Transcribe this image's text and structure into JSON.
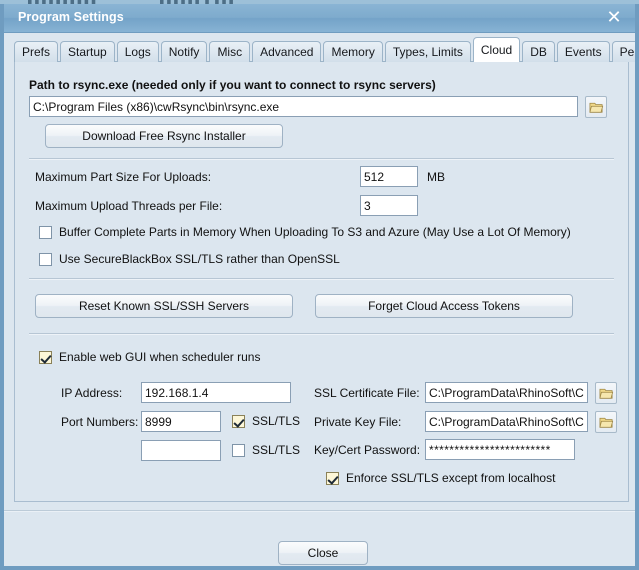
{
  "background": {
    "ghost_text_1": "▌▌▌▌▌▌▌▌▌▌",
    "ghost_text_2": "▌▌▌▌▌▌ ▌ ▌▌▌"
  },
  "window": {
    "title": "Program Settings",
    "close_icon": "✕"
  },
  "tabs": [
    {
      "label": "Prefs",
      "active": false
    },
    {
      "label": "Startup",
      "active": false
    },
    {
      "label": "Logs",
      "active": false
    },
    {
      "label": "Notify",
      "active": false
    },
    {
      "label": "Misc",
      "active": false
    },
    {
      "label": "Advanced",
      "active": false
    },
    {
      "label": "Memory",
      "active": false
    },
    {
      "label": "Types, Limits",
      "active": false
    },
    {
      "label": "Cloud",
      "active": true
    },
    {
      "label": "DB",
      "active": false
    },
    {
      "label": "Events",
      "active": false
    },
    {
      "label": "Performance",
      "active": false
    }
  ],
  "rsync": {
    "label": "Path to rsync.exe  (needed only if you want to connect to rsync servers)",
    "path_value": "C:\\Program Files (x86)\\cwRsync\\bin\\rsync.exe",
    "path_placeholder": "",
    "browse_icon": "folder-icon",
    "download_button": "Download Free Rsync Installer"
  },
  "uploads": {
    "part_size_label": "Maximum Part Size For Uploads:",
    "part_size_value": "512",
    "part_size_unit": "MB",
    "threads_label": "Maximum Upload Threads per File:",
    "threads_value": "3",
    "buffer_checkbox": {
      "label": "Buffer Complete Parts in Memory When Uploading To S3 and Azure (May Use a Lot Of Memory)",
      "checked": false
    },
    "secureblackbox_checkbox": {
      "label": "Use SecureBlackBox SSL/TLS rather than OpenSSL",
      "checked": false
    }
  },
  "actions": {
    "reset_servers": "Reset Known SSL/SSH Servers",
    "forget_tokens": "Forget Cloud Access Tokens"
  },
  "webgui": {
    "enable_checkbox": {
      "label": "Enable web GUI when scheduler runs",
      "checked": true
    },
    "ip_label": "IP Address:",
    "ip_value": "192.168.1.4",
    "port_label": "Port Numbers:",
    "port1_value": "8999",
    "port1_ssl": {
      "label": "SSL/TLS",
      "checked": true
    },
    "port2_value": "",
    "port2_ssl": {
      "label": "SSL/TLS",
      "checked": false
    },
    "cert_label": "SSL Certificate File:",
    "cert_value": "C:\\ProgramData\\RhinoSoft\\Cer",
    "key_label": "Private Key File:",
    "key_value": "C:\\ProgramData\\RhinoSoft\\Cer",
    "password_label": "Key/Cert Password:",
    "password_value": "************************",
    "enforce_checkbox": {
      "label": "Enforce SSL/TLS except from localhost",
      "checked": true
    },
    "browse_icon": "folder-icon"
  },
  "footer": {
    "close_button": "Close"
  },
  "colors": {
    "titlebar": "#7eabcd",
    "panel_bg": "#dce6ef",
    "border": "#6f9cc0",
    "checkbox_checked_bg": "#fdf7d8",
    "folder_icon": "#e8c96a"
  }
}
